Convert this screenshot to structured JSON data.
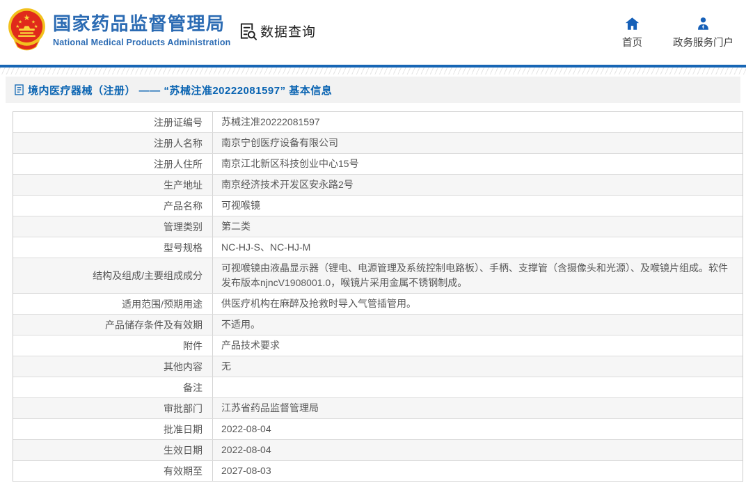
{
  "header": {
    "agency_title_cn": "国家药品监督管理局",
    "agency_title_en": "National Medical Products Administration",
    "query_label": "数据查询",
    "nav": {
      "home_label": "首页",
      "portal_label": "政务服务门户"
    }
  },
  "breadcrumb": {
    "text": "境内医疗器械（注册） —— “苏械注准20222081597” 基本信息"
  },
  "table": {
    "rows": [
      {
        "label": "注册证编号",
        "value": "苏械注准20222081597"
      },
      {
        "label": "注册人名称",
        "value": "南京宁创医疗设备有限公司"
      },
      {
        "label": "注册人住所",
        "value": "南京江北新区科技创业中心15号"
      },
      {
        "label": "生产地址",
        "value": "南京经济技术开发区安永路2号"
      },
      {
        "label": "产品名称",
        "value": "可视喉镜"
      },
      {
        "label": "管理类别",
        "value": "第二类"
      },
      {
        "label": "型号规格",
        "value": "NC-HJ-S、NC-HJ-M"
      },
      {
        "label": "结构及组成/主要组成成分",
        "value": "可视喉镜由液晶显示器（锂电、电源管理及系统控制电路板）、手柄、支撑管（含摄像头和光源）、及喉镜片组成。软件发布版本njncV1908001.0，喉镜片采用金属不锈钢制成。"
      },
      {
        "label": "适用范围/预期用途",
        "value": "供医疗机构在麻醉及抢救时导入气管插管用。"
      },
      {
        "label": "产品储存条件及有效期",
        "value": "不适用。"
      },
      {
        "label": "附件",
        "value": "产品技术要求"
      },
      {
        "label": "其他内容",
        "value": "无"
      },
      {
        "label": "备注",
        "value": ""
      },
      {
        "label": "审批部门",
        "value": "江苏省药品监督管理局"
      },
      {
        "label": "批准日期",
        "value": "2022-08-04"
      },
      {
        "label": "生效日期",
        "value": "2022-08-04"
      },
      {
        "label": "有效期至",
        "value": "2027-08-03"
      }
    ]
  },
  "colors": {
    "brand_blue": "#2b6bb3",
    "link_blue": "#0a64b2",
    "divider_blue": "#1766b5",
    "nav_icon_blue": "#1660b8",
    "row_alt_bg": "#f6f6f6",
    "emblem_red": "#e02a1b",
    "emblem_gold": "#f2c11e"
  }
}
